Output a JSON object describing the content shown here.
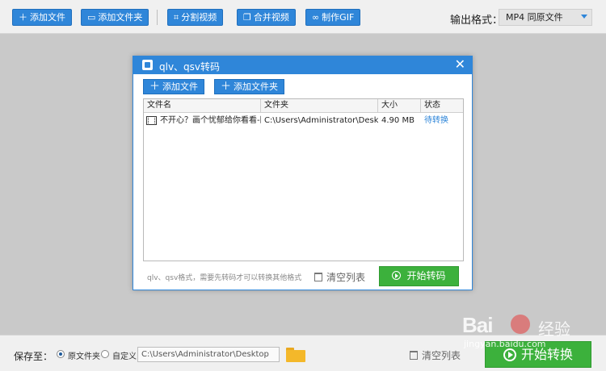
{
  "toolbar": {
    "add_file": "添加文件",
    "add_folder": "添加文件夹",
    "split_video": "分割视频",
    "merge_video": "合并视频",
    "make_gif": "制作GIF",
    "output_format_label": "输出格式：",
    "output_format_value": "MP4  同原文件"
  },
  "dialog": {
    "title": "qlv、qsv转码",
    "add_file": "添加文件",
    "add_folder": "添加文件夹",
    "columns": [
      "文件名",
      "文件夹",
      "大小",
      "状态"
    ],
    "rows": [
      {
        "name": "不开心？画个忧郁给你看看-国",
        "folder": "C:\\Users\\Administrator\\Desktop",
        "size": "4.90 MB",
        "status": "待转换"
      }
    ],
    "hint": "qlv、qsv格式，需要先转码才可以转换其他格式",
    "clear_list": "清空列表",
    "start_convert": "开始转码"
  },
  "bottom": {
    "save_to_label": "保存至：",
    "option_source_folder": "原文件夹",
    "option_custom": "自定义",
    "path_value": "C:\\Users\\Administrator\\Desktop",
    "clear_list": "清空列表",
    "start_convert": "开始转换"
  },
  "watermark": {
    "logo": "Bai",
    "brand": "经验",
    "url": "jingyan.baidu.com"
  },
  "colors": {
    "accent": "#2f86d9",
    "start_green": "#3cb13c",
    "status_link": "#2f86d9"
  }
}
